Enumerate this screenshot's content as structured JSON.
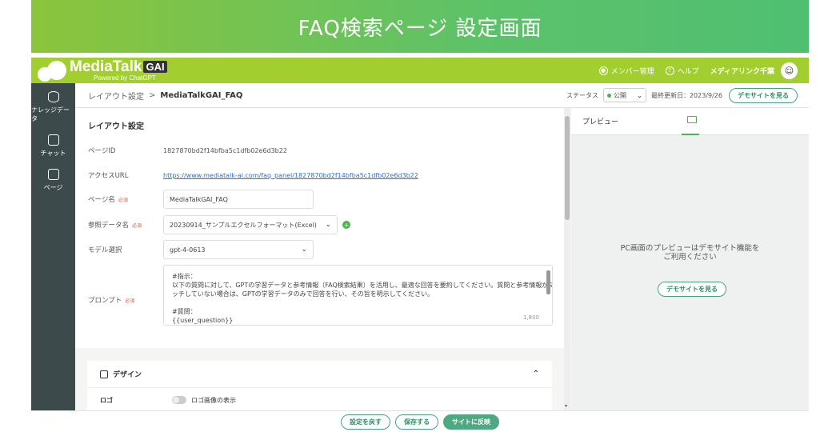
{
  "banner": {
    "title": "FAQ検索ページ 設定画面"
  },
  "header": {
    "logo_main": "MediaTalk",
    "logo_gai": "GAI",
    "logo_sub": "Powered by ChatGPT",
    "member_label": "メンバー管理",
    "help_label": "ヘルプ",
    "company": "メディアリンク千葉",
    "avatar_glyph": "☺"
  },
  "sidebar": {
    "items": [
      {
        "label": "ナレッジデータ",
        "icon": "database-icon"
      },
      {
        "label": "チャット",
        "icon": "chat-icon"
      },
      {
        "label": "ページ",
        "icon": "page-icon"
      }
    ]
  },
  "breadcrumb": {
    "parent": "レイアウト設定",
    "separator": ">",
    "current": "MediaTalkGAI_FAQ"
  },
  "status": {
    "label": "ステータス",
    "value": "公開",
    "updated": "最終更新日：2023/9/26",
    "demo_button": "デモサイトを見る"
  },
  "form": {
    "title": "レイアウト設定",
    "page_id_label": "ページID",
    "page_id_value": "1827870bd2f14bfba5c1dfb02e6d3b22",
    "access_url_label": "アクセスURL",
    "access_url_value": "https://www.mediatalk-ai.com/faq_panel/1827870bd2f14bfba5c1dfb02e6d3b22",
    "page_name_label": "ページ名",
    "required": "必須",
    "page_name_value": "MediaTalkGAI_FAQ",
    "ref_data_label": "参照データ名",
    "ref_data_value": "20230914_サンプルエクセルフォーマット(Excel)",
    "model_label": "モデル選択",
    "model_value": "gpt-4-0613",
    "prompt_label": "プロンプト",
    "prompt_lines": [
      "#指示：",
      "以下の質問に対して、GPTの学習データと参考情報（FAQ検索結果）を活用し、最適な回答を要約してください。質問と参考情報がマ",
      "ッチしていない場合は、GPTの学習データのみで回答を行い、その旨を明示してください。",
      "",
      "#質問：",
      "{{user_question}}",
      ""
    ],
    "prompt_count": "1,800"
  },
  "design": {
    "title": "デザイン",
    "logo_label": "ロゴ",
    "logo_toggle_label": "ロゴ画像の表示"
  },
  "preview": {
    "title": "プレビュー",
    "message_line1": "PC画面のプレビューはデモサイト機能を",
    "message_line2": "ご利用ください",
    "demo_button": "デモサイトを見る"
  },
  "footer": {
    "reset_button": "設定を戻す",
    "save_button": "保存する",
    "publish_button": "サイトに反映"
  }
}
